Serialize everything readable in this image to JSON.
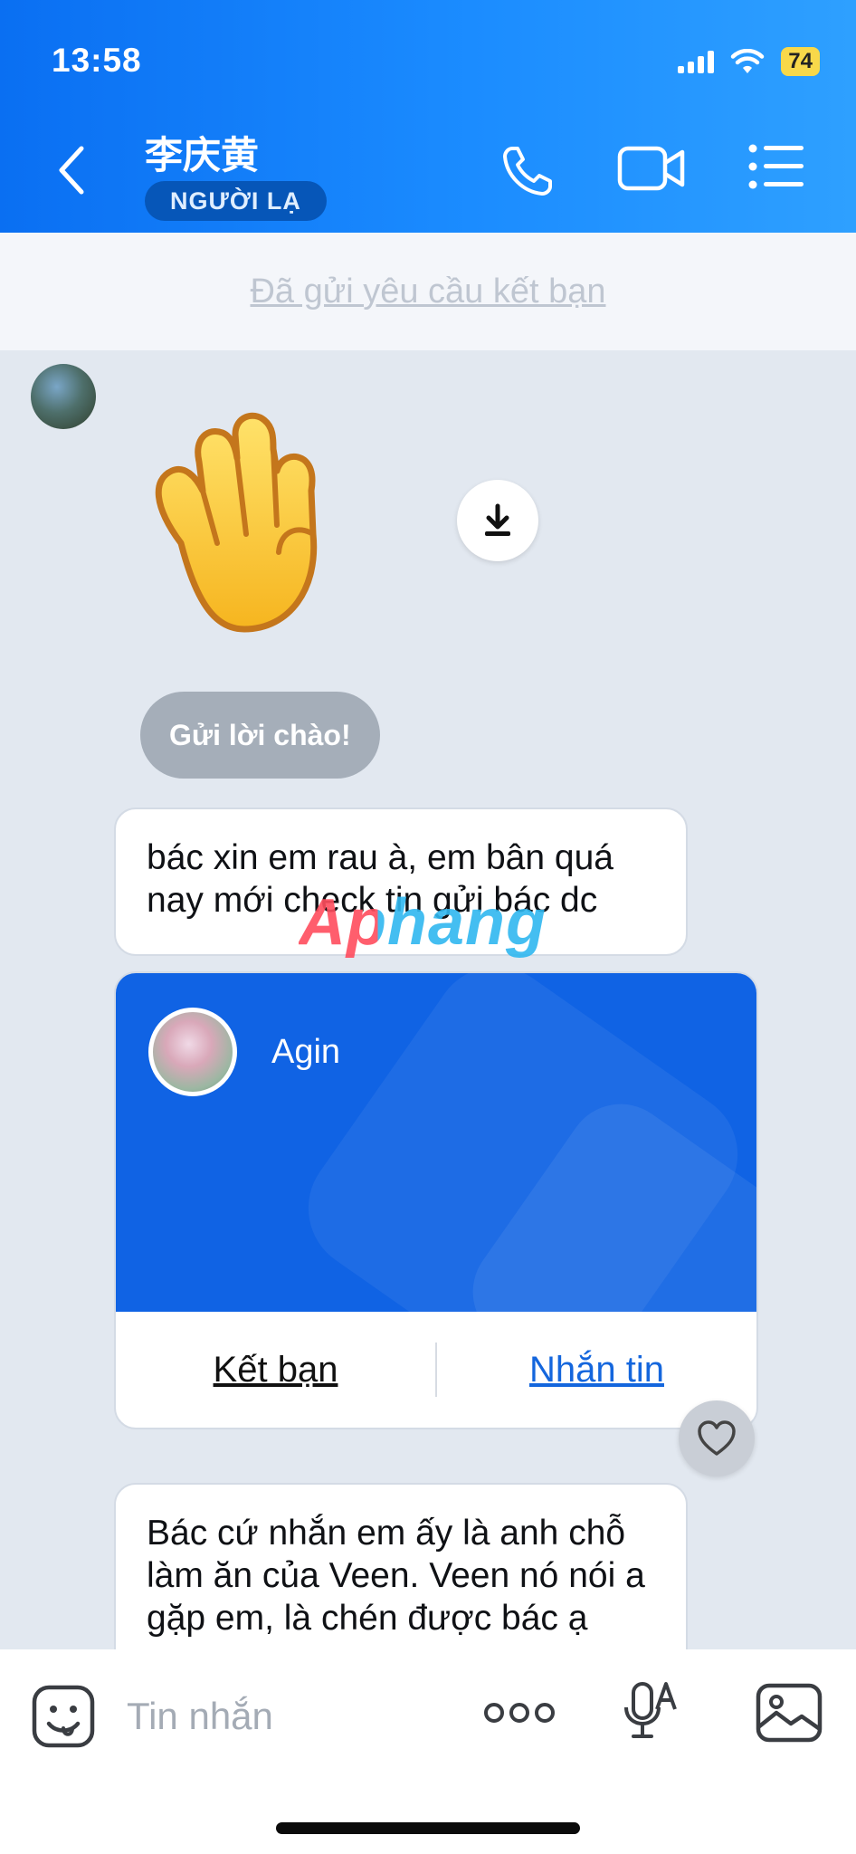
{
  "status_bar": {
    "time": "13:58",
    "battery": "74"
  },
  "header": {
    "contact_name": "李庆黄",
    "badge": "NGƯỜI LẠ",
    "icons": [
      "back-icon",
      "phone-icon",
      "video-icon",
      "menu-icon"
    ]
  },
  "request_bar": {
    "text": "Đã gửi yêu cầu kết bạn"
  },
  "chat": {
    "greet_chip": "Gửi lời chào!",
    "message_1": "bác xin em rau à, em bân quá nay mới check tin gửi bác dc",
    "contact_card": {
      "name": "Agin",
      "add_friend": "Kết bạn",
      "message": "Nhắn tin"
    },
    "message_2": "Bác cứ nhắn em ấy là anh chỗ làm ăn của Veen. Veen nó nói a gặp em, là chén được bác ạ"
  },
  "watermark": "Aphang",
  "composer": {
    "placeholder": "Tin nhắn",
    "icons": [
      "emoji-icon",
      "more-icon",
      "voice-icon",
      "image-icon"
    ]
  },
  "colors": {
    "header": "#0a6ff2",
    "accent": "#1466dd",
    "battery": "#f8d84a"
  }
}
